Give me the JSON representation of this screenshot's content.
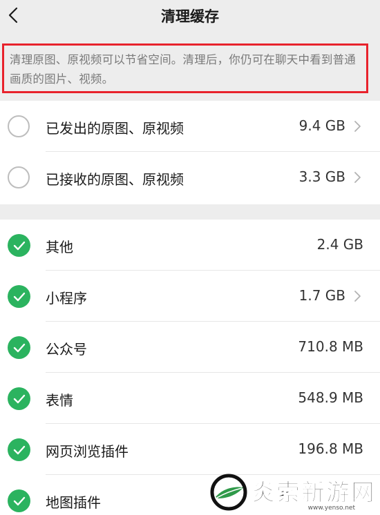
{
  "header": {
    "title": "清理缓存",
    "back_icon": "chevron-left-icon"
  },
  "notice": {
    "text": "清理原图、原视频可以节省空间。清理后，你仍可在聊天中看到普通画质的图片、视频。"
  },
  "colors": {
    "accent_green": "#2bb35f",
    "highlight_border": "#e8222c",
    "background": "#ededed"
  },
  "group1": {
    "items": [
      {
        "label": "已发出的原图、原视频",
        "size": "9.4 GB",
        "checked": false,
        "has_arrow": true
      },
      {
        "label": "已接收的原图、原视频",
        "size": "3.3 GB",
        "checked": false,
        "has_arrow": true
      }
    ]
  },
  "group2": {
    "items": [
      {
        "label": "其他",
        "size": "2.4 GB",
        "checked": true,
        "has_arrow": false
      },
      {
        "label": "小程序",
        "size": "1.7 GB",
        "checked": true,
        "has_arrow": true
      },
      {
        "label": "公众号",
        "size": "710.8 MB",
        "checked": true,
        "has_arrow": false
      },
      {
        "label": "表情",
        "size": "548.9 MB",
        "checked": true,
        "has_arrow": false
      },
      {
        "label": "网页浏览插件",
        "size": "196.8 MB",
        "checked": true,
        "has_arrow": false
      },
      {
        "label": "地图插件",
        "size": "",
        "checked": true,
        "has_arrow": false
      }
    ]
  },
  "watermark": {
    "text": "炎索新游网",
    "url": "www.yenso.net",
    "logo_icon": "leaf-logo-icon"
  }
}
